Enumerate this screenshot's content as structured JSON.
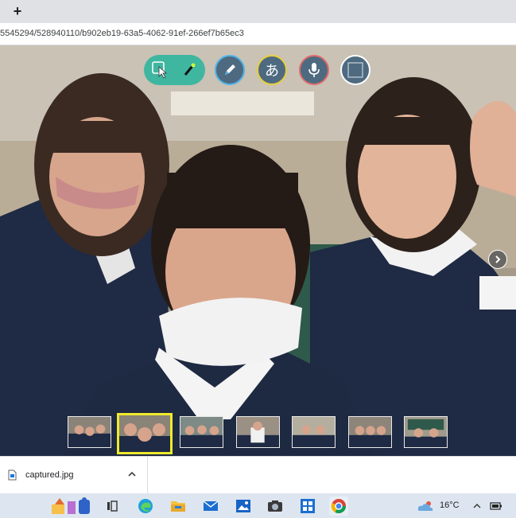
{
  "browser": {
    "new_tab_symbol": "+",
    "url": "5545294/528940110/b902eb19-63a5-4062-91ef-266ef7b65ec3"
  },
  "toolbar": {
    "tools": [
      {
        "name": "pointer-icon"
      },
      {
        "name": "laser-pointer-icon"
      },
      {
        "name": "pen-icon",
        "ring": "#4fb3e8"
      },
      {
        "name": "text-input-icon",
        "glyph": "あ",
        "ring": "#e8cf3a"
      },
      {
        "name": "microphone-icon",
        "ring": "#e36a6a"
      },
      {
        "name": "square-frame-icon",
        "ring": "#ffffff"
      }
    ]
  },
  "gallery": {
    "selected_index": 1,
    "thumbnail_count": 7,
    "accent_color": "#f0ea2b"
  },
  "download": {
    "filename": "captured.jpg"
  },
  "taskbar": {
    "temperature": "16°C",
    "icons": [
      "widgets-icon",
      "task-view-icon",
      "edge-icon",
      "file-explorer-icon",
      "mail-icon",
      "photos-icon",
      "camera-icon",
      "store-icon",
      "chrome-icon",
      "weather-icon",
      "show-hidden-icons-icon",
      "battery-icon"
    ]
  }
}
